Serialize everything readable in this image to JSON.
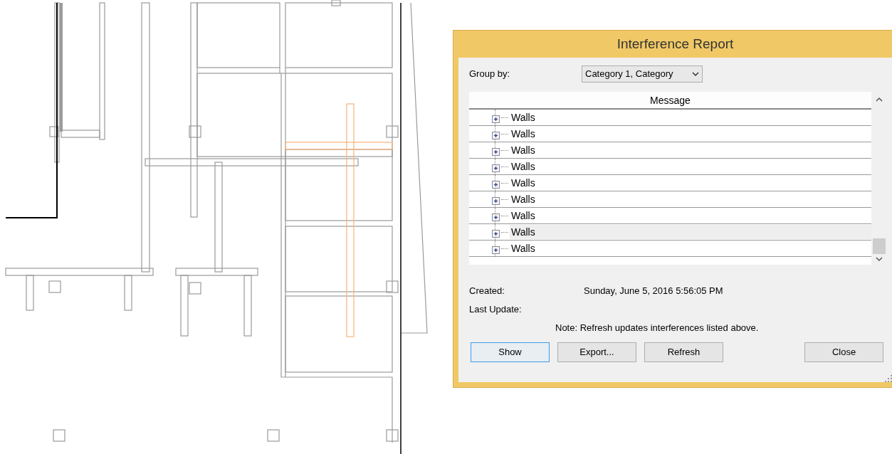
{
  "window": {
    "title": "Interference Report"
  },
  "group_by": {
    "label": "Group by:",
    "value": "Category 1, Category"
  },
  "table": {
    "columns": [
      "Message"
    ],
    "rows": [
      {
        "label": "Walls",
        "expanded": false,
        "selected": false
      },
      {
        "label": "Walls",
        "expanded": false,
        "selected": false
      },
      {
        "label": "Walls",
        "expanded": false,
        "selected": false
      },
      {
        "label": "Walls",
        "expanded": false,
        "selected": false
      },
      {
        "label": "Walls",
        "expanded": false,
        "selected": false
      },
      {
        "label": "Walls",
        "expanded": false,
        "selected": false
      },
      {
        "label": "Walls",
        "expanded": false,
        "selected": false
      },
      {
        "label": "Walls",
        "expanded": false,
        "selected": true
      },
      {
        "label": "Walls",
        "expanded": false,
        "selected": false
      }
    ]
  },
  "created": {
    "label": "Created:",
    "value": "Sunday, June 5, 2016 5:56:05 PM"
  },
  "last_update": {
    "label": "Last Update:"
  },
  "note": "Note: Refresh updates interferences listed above.",
  "buttons": [
    {
      "label": "Show",
      "focused": true
    },
    {
      "label": "Export...",
      "focused": false
    },
    {
      "label": "Refresh",
      "focused": false
    },
    {
      "label": "Close",
      "focused": false
    }
  ]
}
